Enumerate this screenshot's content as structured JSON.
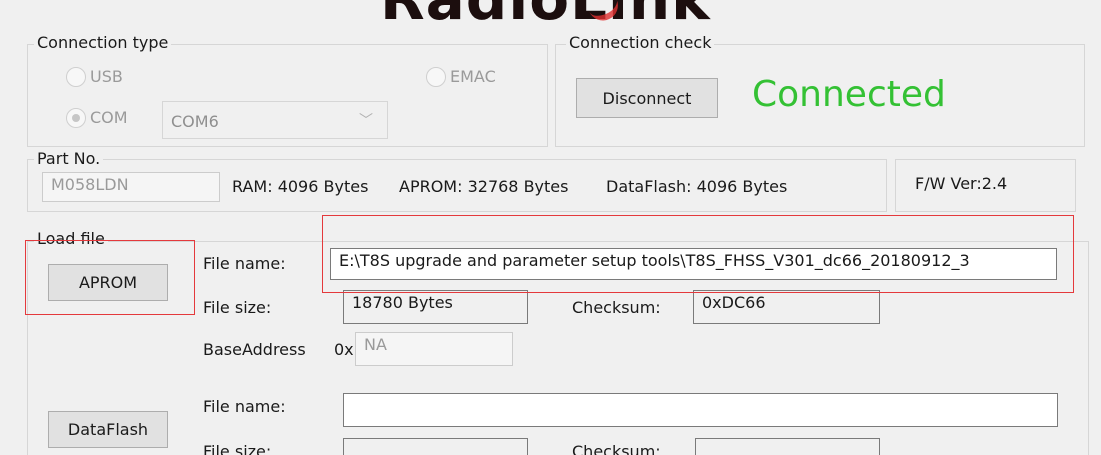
{
  "logo": {
    "text": "RadioLink"
  },
  "connection_type": {
    "title": "Connection type",
    "usb_label": "USB",
    "emac_label": "EMAC",
    "com_label": "COM",
    "com_port_value": "COM6",
    "selected": "COM"
  },
  "connection_check": {
    "title": "Connection check",
    "disconnect_label": "Disconnect",
    "status": "Connected",
    "status_color": "#34c134"
  },
  "part_no": {
    "title": "Part No.",
    "value": "M058LDN",
    "ram": "RAM: 4096 Bytes",
    "aprom": "APROM: 32768 Bytes",
    "dataflash": "DataFlash: 4096 Bytes",
    "fw_version": "F/W Ver:2.4"
  },
  "load_file": {
    "title": "Load file",
    "aprom": {
      "button_label": "APROM",
      "file_name_label": "File name:",
      "file_name_value": "E:\\T8S upgrade and parameter setup tools\\T8S_FHSS_V301_dc66_20180912_3",
      "file_size_label": "File size:",
      "file_size_value": "18780 Bytes",
      "checksum_label": "Checksum:",
      "checksum_value": "0xDC66",
      "base_address_label": "BaseAddress",
      "base_address_prefix": "0x",
      "base_address_value": "NA"
    },
    "dataflash": {
      "button_label": "DataFlash",
      "file_name_label": "File name:",
      "file_name_value": "",
      "file_size_label": "File size:",
      "file_size_value": "",
      "checksum_label": "Checksum:",
      "checksum_value": ""
    }
  },
  "colors": {
    "highlight": "#e4393c",
    "background": "#f0f0f0"
  }
}
